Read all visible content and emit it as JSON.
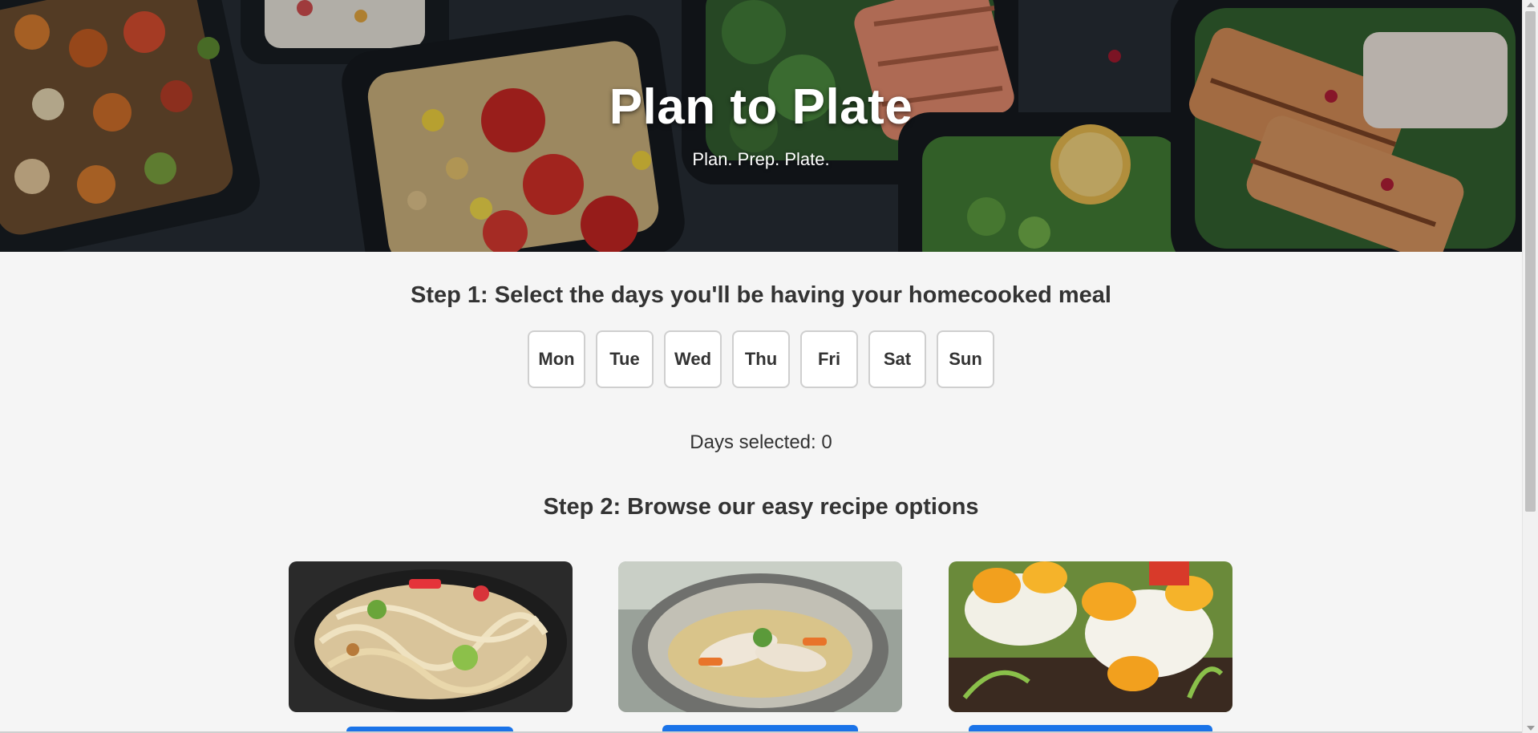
{
  "hero": {
    "title": "Plan to Plate",
    "tagline": "Plan. Prep. Plate."
  },
  "step1": {
    "heading": "Step 1: Select the days you'll be having your homecooked meal",
    "days": [
      "Mon",
      "Tue",
      "Wed",
      "Thu",
      "Fri",
      "Sat",
      "Sun"
    ],
    "days_selected_label": "Days selected: 0"
  },
  "step2": {
    "heading": "Step 2: Browse our easy recipe options"
  },
  "colors": {
    "accent": "#1a73e8",
    "background": "#f5f5f5",
    "text": "#333333"
  }
}
